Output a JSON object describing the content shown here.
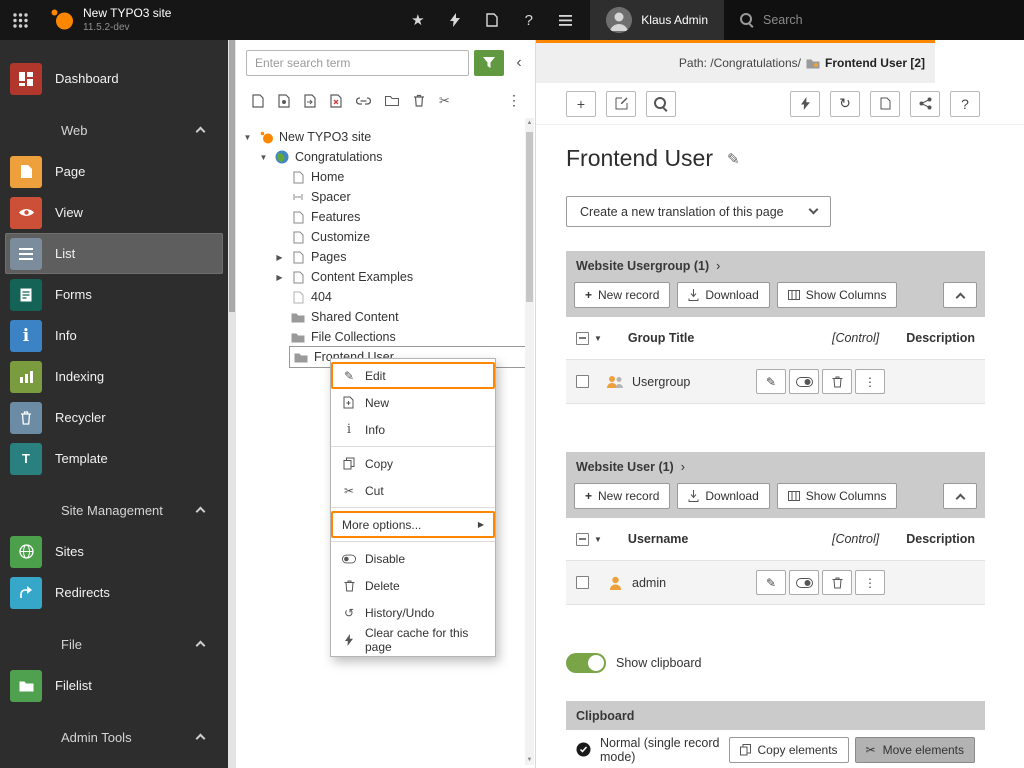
{
  "colors": {
    "accent_orange": "#ff8700",
    "toggle_green": "#79a548",
    "topbar_black": "#161616",
    "sidebar_gray": "#2d2d2d"
  },
  "topbar": {
    "site_name": "New TYPO3 site",
    "version": "11.5.2-dev",
    "user_name": "Klaus Admin",
    "search_placeholder": "Search",
    "icons": [
      "apps-grid-icon",
      "typo3-logo",
      "bookmark-icon",
      "clear-cache-icon",
      "opendocs-icon",
      "help-icon",
      "systemlog-icon",
      "avatar",
      "search-icon"
    ]
  },
  "sidebar": {
    "items": [
      {
        "label": "Dashboard",
        "icon": "dashboard-icon"
      },
      {
        "label": "Web",
        "icon": "chevron-up-icon"
      },
      {
        "label": "Page",
        "icon": "page-icon"
      },
      {
        "label": "View",
        "icon": "view-icon"
      },
      {
        "label": "List",
        "icon": "list-icon",
        "selected": true
      },
      {
        "label": "Forms",
        "icon": "forms-icon"
      },
      {
        "label": "Info",
        "icon": "info-icon"
      },
      {
        "label": "Indexing",
        "icon": "indexing-icon"
      },
      {
        "label": "Recycler",
        "icon": "recycler-icon"
      },
      {
        "label": "Template",
        "icon": "template-icon"
      },
      {
        "label": "Site Management",
        "icon": "chevron-up-icon"
      },
      {
        "label": "Sites",
        "icon": "sites-icon"
      },
      {
        "label": "Redirects",
        "icon": "redirects-icon"
      },
      {
        "label": "File",
        "icon": "chevron-up-icon"
      },
      {
        "label": "Filelist",
        "icon": "filelist-icon"
      },
      {
        "label": "Admin Tools",
        "icon": "chevron-up-icon"
      }
    ]
  },
  "pagetree": {
    "search_placeholder": "Enter search term",
    "nodes": [
      {
        "label": "New TYPO3 site",
        "icon": "typo3-site-icon"
      },
      {
        "label": "Congratulations",
        "icon": "globe-icon"
      },
      {
        "label": "Home",
        "icon": "page-doc-icon"
      },
      {
        "label": "Spacer",
        "icon": "spacer-icon"
      },
      {
        "label": "Features",
        "icon": "page-doc-icon"
      },
      {
        "label": "Customize",
        "icon": "page-doc-icon"
      },
      {
        "label": "Pages",
        "icon": "page-doc-icon"
      },
      {
        "label": "Content Examples",
        "icon": "page-doc-icon"
      },
      {
        "label": "404",
        "icon": "page-doc-icon"
      },
      {
        "label": "Shared Content",
        "icon": "folder-icon"
      },
      {
        "label": "File Collections",
        "icon": "folder-icon"
      },
      {
        "label": "Frontend User",
        "icon": "folder-icon",
        "selected": true
      }
    ]
  },
  "context_menu": {
    "items": [
      {
        "label": "Edit",
        "icon": "edit-icon"
      },
      {
        "label": "New",
        "icon": "new-icon"
      },
      {
        "label": "Info",
        "icon": "info-icon"
      },
      {
        "label": "Copy",
        "icon": "copy-icon"
      },
      {
        "label": "Cut",
        "icon": "cut-icon"
      },
      {
        "label": "More options...",
        "icon": "none"
      },
      {
        "label": "Disable",
        "icon": "toggle-icon"
      },
      {
        "label": "Delete",
        "icon": "trash-icon"
      },
      {
        "label": "History/Undo",
        "icon": "history-icon"
      },
      {
        "label": "Clear cache for this page",
        "icon": "bolt-icon"
      }
    ]
  },
  "content": {
    "path_label": "Path: /Congratulations/",
    "page_ref": "Frontend User [2]",
    "title": "Frontend User",
    "translation_button": "Create a new translation of this page",
    "usergroup_section": {
      "title": "Website Usergroup (1)",
      "new_record": "New record",
      "download": "Download",
      "show_columns": "Show Columns",
      "col_title": "Group Title",
      "col_control": "[Control]",
      "col_description": "Description",
      "row_title": "Usergroup"
    },
    "user_section": {
      "title": "Website User (1)",
      "new_record": "New record",
      "download": "Download",
      "show_columns": "Show Columns",
      "col_title": "Username",
      "col_control": "[Control]",
      "col_description": "Description",
      "row_title": "admin"
    },
    "clipboard": {
      "toggle_label": "Show clipboard",
      "title": "Clipboard",
      "mode_label": "Normal (single record mode)",
      "copy_elements": "Copy elements",
      "move_elements": "Move elements"
    }
  }
}
